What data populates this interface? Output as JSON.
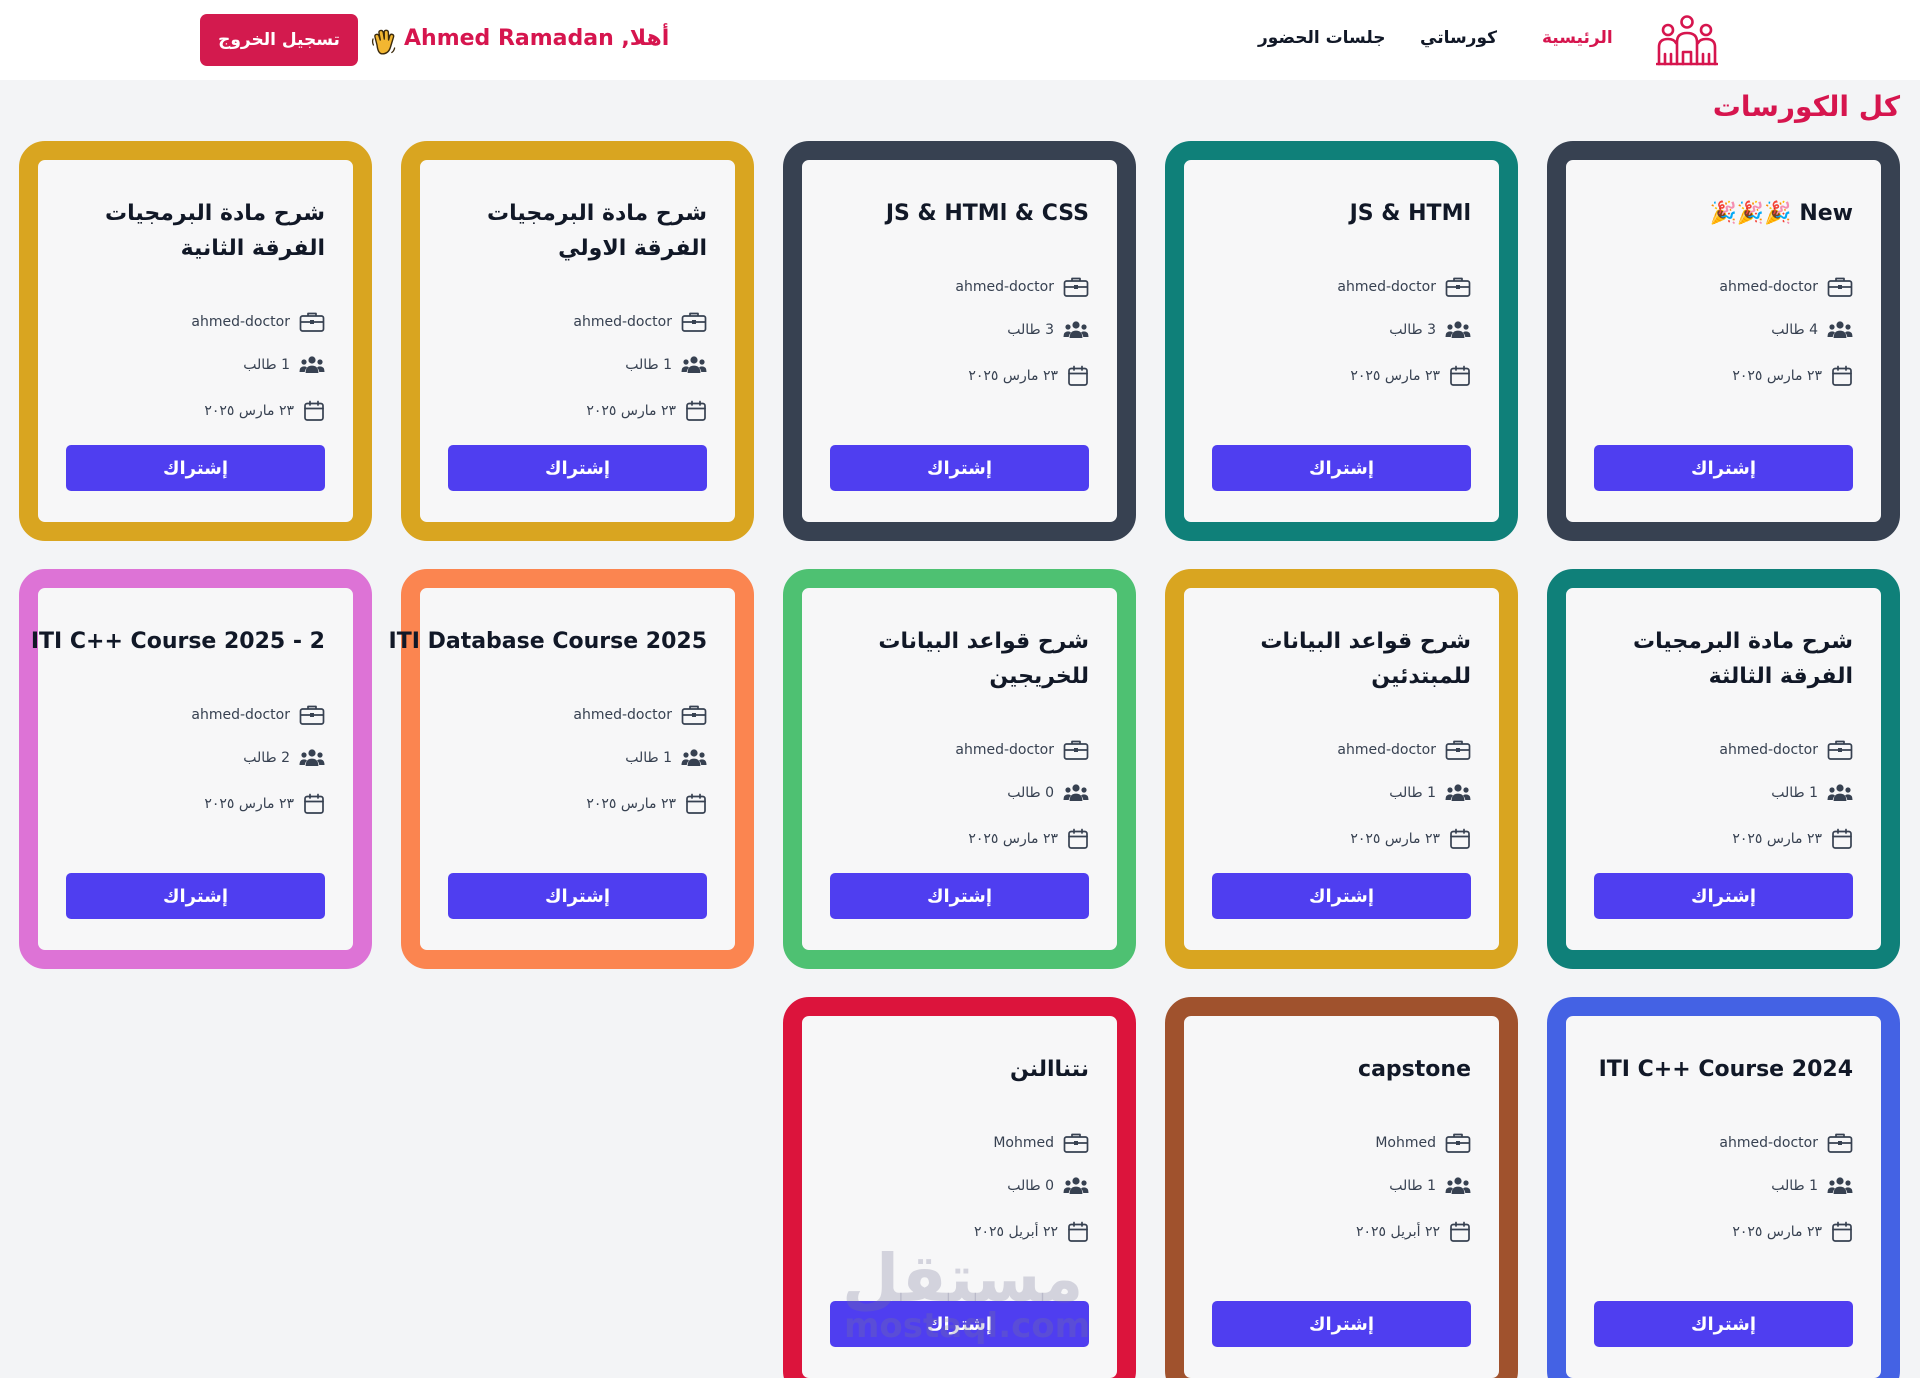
{
  "nav": {
    "home": "الرئيسية",
    "my_courses": "كورساتي",
    "attendance": "جلسات الحضور",
    "greeting": "أهلا, Ahmed Ramadan",
    "logout": "تسجيل الخروج",
    "greeting_icon": "waving-hand-icon",
    "logo_icon": "people-group-icon"
  },
  "page": {
    "title": "كل الكورسات"
  },
  "colors": {
    "accent": "#d6154e",
    "button": "#4f3ef0"
  },
  "courses": [
    {
      "title": "New 🎉🎉🎉",
      "instructor": "ahmed-doctor",
      "students": "4 طالب",
      "date": "٢٣ مارس ٢٠٢٥",
      "join": "إشتراك",
      "border_color": "#374151"
    },
    {
      "title": "JS & HTMl",
      "instructor": "ahmed-doctor",
      "students": "3 طالب",
      "date": "٢٣ مارس ٢٠٢٥",
      "join": "إشتراك",
      "border_color": "#0f8079"
    },
    {
      "title": "JS & HTMl & CSS",
      "instructor": "ahmed-doctor",
      "students": "3 طالب",
      "date": "٢٣ مارس ٢٠٢٥",
      "join": "إشتراك",
      "border_color": "#374151"
    },
    {
      "title": "شرح مادة البرمجيات الفرقة الاولي",
      "instructor": "ahmed-doctor",
      "students": "1 طالب",
      "date": "٢٣ مارس ٢٠٢٥",
      "join": "إشتراك",
      "border_color": "#d9a520"
    },
    {
      "title": "شرح مادة البرمجيات الفرقة الثانية",
      "instructor": "ahmed-doctor",
      "students": "1 طالب",
      "date": "٢٣ مارس ٢٠٢٥",
      "join": "إشتراك",
      "border_color": "#d9a520"
    },
    {
      "title": "شرح مادة البرمجيات الفرقة الثالثة",
      "instructor": "ahmed-doctor",
      "students": "1 طالب",
      "date": "٢٣ مارس ٢٠٢٥",
      "join": "إشتراك",
      "border_color": "#0f8079"
    },
    {
      "title": "شرح قواعد البيانات للمبتدئين",
      "instructor": "ahmed-doctor",
      "students": "1 طالب",
      "date": "٢٣ مارس ٢٠٢٥",
      "join": "إشتراك",
      "border_color": "#d9a520"
    },
    {
      "title": "شرح قواعد البيانات للخريجين",
      "instructor": "ahmed-doctor",
      "students": "0 طالب",
      "date": "٢٣ مارس ٢٠٢٥",
      "join": "إشتراك",
      "border_color": "#4ec172"
    },
    {
      "title": "ITI Database Course 2025",
      "instructor": "ahmed-doctor",
      "students": "1 طالب",
      "date": "٢٣ مارس ٢٠٢٥",
      "join": "إشتراك",
      "border_color": "#fb8550"
    },
    {
      "title": "ITI C++ Course 2025 - 2",
      "instructor": "ahmed-doctor",
      "students": "2 طالب",
      "date": "٢٣ مارس ٢٠٢٥",
      "join": "إشتراك",
      "border_color": "#dd73d6"
    },
    {
      "title": "ITI C++ Course 2024",
      "instructor": "ahmed-doctor",
      "students": "1 طالب",
      "date": "٢٣ مارس ٢٠٢٥",
      "join": "إشتراك",
      "border_color": "#4462e4"
    },
    {
      "title": "capstone",
      "instructor": "Mohmed",
      "students": "1 طالب",
      "date": "٢٢ أبريل ٢٠٢٥",
      "join": "إشتراك",
      "border_color": "#a0522d"
    },
    {
      "title": "نتناالنن",
      "instructor": "Mohmed",
      "students": "0 طالب",
      "date": "٢٢ أبريل ٢٠٢٥",
      "join": "إشتراك",
      "border_color": "#dc143c"
    }
  ],
  "watermark": {
    "arabic": "مستقل",
    "latin": "mostaql.com"
  }
}
